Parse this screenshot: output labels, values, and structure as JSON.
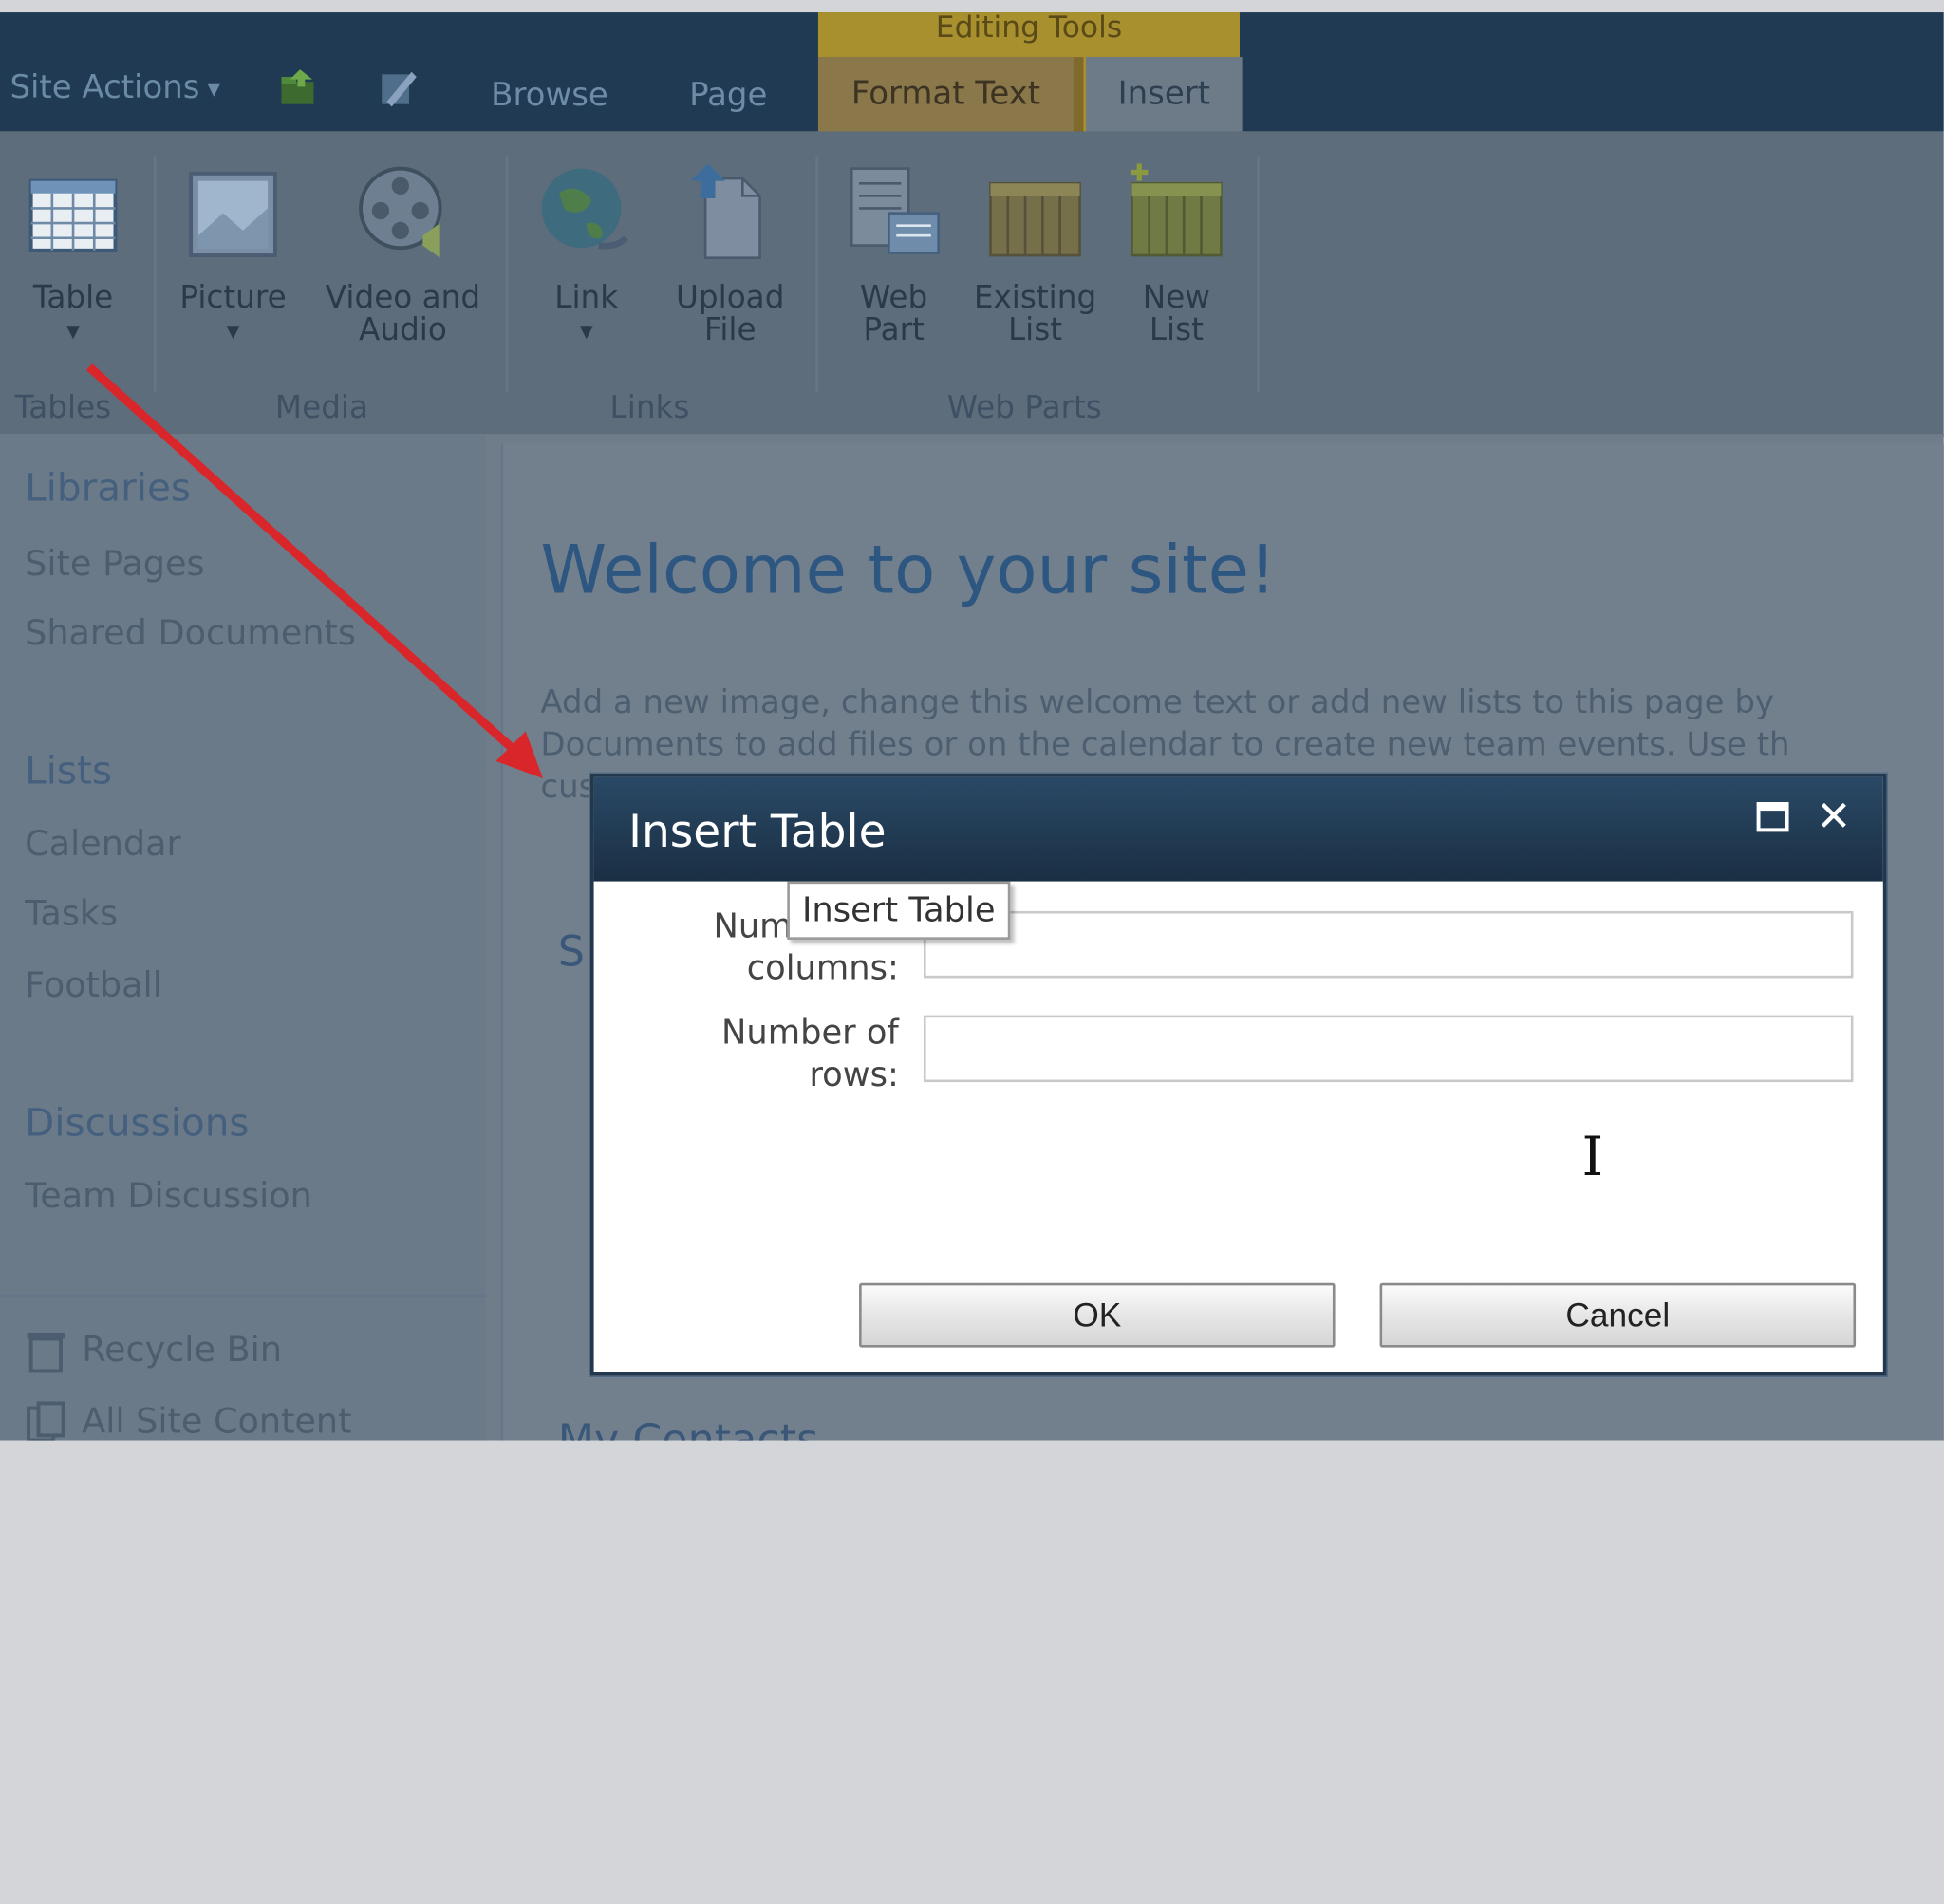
{
  "topbar": {
    "site_actions": "Site Actions",
    "tabs": {
      "browse": "Browse",
      "page": "Page",
      "format_text": "Format Text",
      "insert": "Insert"
    },
    "contextual_group": "Editing Tools"
  },
  "ribbon": {
    "buttons": [
      {
        "label": "Table"
      },
      {
        "label": "Picture"
      },
      {
        "label": "Video and",
        "label2": "Audio"
      },
      {
        "label": "Link"
      },
      {
        "label": "Upload",
        "label2": "File"
      },
      {
        "label": "Web",
        "label2": "Part"
      },
      {
        "label": "Existing",
        "label2": "List"
      },
      {
        "label": "New",
        "label2": "List"
      }
    ],
    "groups": {
      "tables": "Tables",
      "media": "Media",
      "links": "Links",
      "web_parts": "Web Parts"
    }
  },
  "nav": {
    "libraries": "Libraries",
    "site_pages": "Site Pages",
    "shared_documents": "Shared Documents",
    "lists": "Lists",
    "calendar": "Calendar",
    "tasks": "Tasks",
    "football": "Football",
    "discussions": "Discussions",
    "team_discussion": "Team Discussion",
    "recycle_bin": "Recycle Bin",
    "all_site_content": "All Site Content"
  },
  "main": {
    "welcome": "Welcome to your site!",
    "intro": "Add a new image, change this welcome text or add new lists to this page by\nDocuments to add files or on the calendar to create new team events. Use th\ncustomize tools",
    "partial_heading": "S",
    "my_contacts": "My Contacts"
  },
  "dialog": {
    "title": "Insert Table",
    "columns_label_1": "Num",
    "columns_label_2": "columns:",
    "rows_label_1": "Number of",
    "rows_label_2": "rows:",
    "tooltip": "Insert Table",
    "columns_value": "",
    "rows_value": "",
    "ok": "OK",
    "cancel": "Cancel"
  },
  "colors": {
    "annotation_arrow": "#d9262a",
    "topbar": "#1f3a52"
  }
}
